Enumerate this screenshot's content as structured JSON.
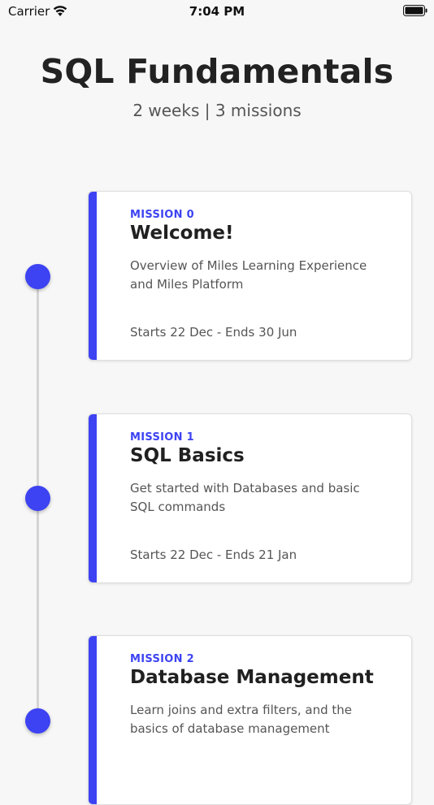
{
  "status_bar": {
    "carrier": "Carrier",
    "time": "7:04 PM",
    "wifi_icon": "wifi-icon",
    "battery_icon": "battery-icon"
  },
  "header": {
    "title": "SQL Fundamentals",
    "subtitle": "2 weeks | 3 missions"
  },
  "colors": {
    "accent": "#3d43f2",
    "background": "#f7f7f7",
    "timeline": "#d4d4d4"
  },
  "missions": [
    {
      "label": "MISSION 0",
      "title": "Welcome!",
      "description": "Overview of Miles Learning Experience and Miles Platform",
      "dates": "Starts 22 Dec - Ends 30 Jun"
    },
    {
      "label": "MISSION 1",
      "title": "SQL Basics",
      "description": "Get started with Databases and basic SQL commands",
      "dates": "Starts 22 Dec - Ends 21 Jan"
    },
    {
      "label": "MISSION 2",
      "title": "Database Management",
      "description": "Learn joins and extra filters, and the basics of database management",
      "dates": ""
    }
  ]
}
